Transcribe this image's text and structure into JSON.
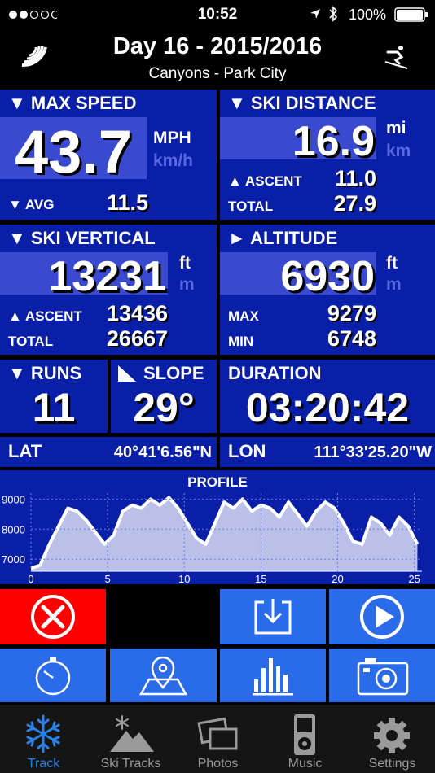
{
  "status": {
    "time": "10:52",
    "battery": "100%"
  },
  "header": {
    "title": "Day 16 - 2015/2016",
    "subtitle": "Canyons - Park City"
  },
  "max_speed": {
    "title": "▼ MAX SPEED",
    "value": "43.7",
    "unit": "MPH",
    "unit_alt": "km/h",
    "avg_label": "▼ AVG",
    "avg_value": "11.5"
  },
  "ski_distance": {
    "title": "▼ SKI DISTANCE",
    "value": "16.9",
    "unit": "mi",
    "unit_alt": "km",
    "ascent_label": "▲ ASCENT",
    "ascent_value": "11.0",
    "total_label": "TOTAL",
    "total_value": "27.9"
  },
  "ski_vertical": {
    "title": "▼ SKI VERTICAL",
    "value": "13231",
    "unit": "ft",
    "unit_alt": "m",
    "ascent_label": "▲ ASCENT",
    "ascent_value": "13436",
    "total_label": "TOTAL",
    "total_value": "26667"
  },
  "altitude": {
    "title": "► ALTITUDE",
    "value": "6930",
    "unit": "ft",
    "unit_alt": "m",
    "max_label": "MAX",
    "max_value": "9279",
    "min_label": "MIN",
    "min_value": "6748"
  },
  "runs": {
    "title": "▼ RUNS",
    "value": "11"
  },
  "slope": {
    "title": "SLOPE",
    "value": "29°"
  },
  "duration": {
    "title": "DURATION",
    "value": "03:20:42"
  },
  "lat": {
    "label": "LAT",
    "value": "40°41'6.56\"N"
  },
  "lon": {
    "label": "LON",
    "value": "111°33'25.20\"W"
  },
  "chart_data": {
    "type": "area",
    "title": "PROFILE",
    "xlim": [
      0,
      25.5
    ],
    "ylim": [
      6600,
      9200
    ],
    "xticks": [
      "0",
      "5",
      "10",
      "15",
      "20",
      "25"
    ],
    "yticks": [
      "9000",
      "8000",
      "7000"
    ],
    "x": [
      0,
      0.6,
      1.2,
      1.8,
      2.4,
      3,
      3.6,
      4.2,
      4.8,
      5.4,
      6,
      6.6,
      7.2,
      7.8,
      8.4,
      9,
      9.6,
      10.2,
      10.8,
      11.4,
      12,
      12.6,
      13.2,
      13.8,
      14.4,
      15,
      15.6,
      16.2,
      16.8,
      17.4,
      18,
      18.6,
      19.2,
      19.8,
      20.4,
      21,
      21.6,
      22.2,
      22.8,
      23.4,
      24,
      24.6,
      25.2
    ],
    "y": [
      6700,
      6800,
      7500,
      8100,
      8700,
      8600,
      8300,
      7900,
      7500,
      7800,
      8600,
      8800,
      8700,
      9000,
      8800,
      9050,
      8700,
      8200,
      7700,
      7500,
      8200,
      8900,
      8700,
      9000,
      8600,
      8800,
      8700,
      8400,
      8900,
      8500,
      8100,
      8600,
      8900,
      8700,
      8200,
      7600,
      7500,
      8400,
      8200,
      7800,
      8400,
      8100,
      7500
    ],
    "colors": {
      "fill": "#ffffff",
      "background": "#0a1fa8"
    }
  },
  "tabs": [
    {
      "label": "Track",
      "icon": "snowflake-icon",
      "active": true
    },
    {
      "label": "Ski Tracks",
      "icon": "mountain-icon",
      "active": false
    },
    {
      "label": "Photos",
      "icon": "photos-icon",
      "active": false
    },
    {
      "label": "Music",
      "icon": "ipod-icon",
      "active": false
    },
    {
      "label": "Settings",
      "icon": "gear-icon",
      "active": false
    }
  ],
  "colors": {
    "panel": "#0a1fa8",
    "button": "#2a6bea",
    "stop": "#ff0000",
    "tab_active": "#2b82e6"
  }
}
